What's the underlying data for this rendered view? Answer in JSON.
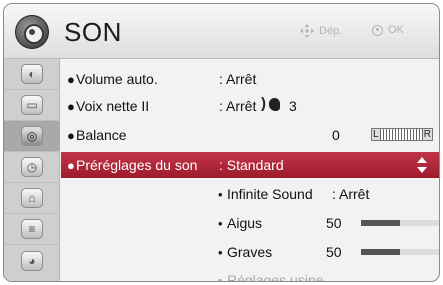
{
  "header": {
    "title": "SON",
    "hint_move": "Dép.",
    "hint_ok": "OK"
  },
  "sidebar": {
    "items": [
      {
        "name": "picture",
        "icon": "picture-icon"
      },
      {
        "name": "screen",
        "icon": "screen-icon"
      },
      {
        "name": "sound",
        "icon": "sound-icon",
        "active": true
      },
      {
        "name": "time",
        "icon": "clock-icon"
      },
      {
        "name": "lock",
        "icon": "lock-icon"
      },
      {
        "name": "input",
        "icon": "input-icon"
      },
      {
        "name": "support",
        "icon": "support-icon"
      }
    ]
  },
  "menu": {
    "volume_auto": {
      "label": "Volume auto.",
      "value": ": Arrêt"
    },
    "voix_nette": {
      "label": "Voix nette II",
      "value": ": Arrêt",
      "level": "3"
    },
    "balance": {
      "label": "Balance",
      "value": "0",
      "left": "L",
      "right": "R"
    },
    "preglages": {
      "label": "Préréglages du son",
      "value": ": Standard"
    },
    "infinite": {
      "label": "Infinite Sound",
      "value": ": Arrêt"
    },
    "aigus": {
      "label": "Aigus",
      "value": "50",
      "level": 0.5
    },
    "graves": {
      "label": "Graves",
      "value": "50",
      "level": 0.5
    },
    "reglages": {
      "label": "Réglages usine"
    }
  },
  "colors": {
    "selected": "#b02a3c",
    "slider_fill": "#555555"
  }
}
